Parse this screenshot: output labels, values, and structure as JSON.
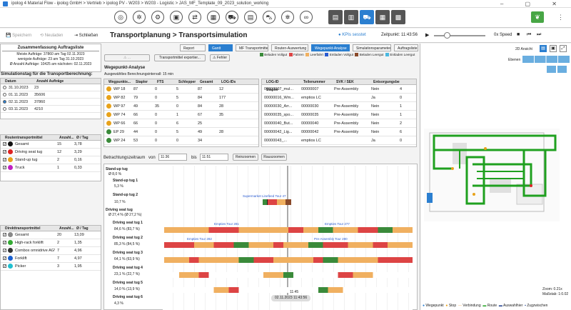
{
  "window": {
    "title": "ipolog 4 Material Flow - ipolog GmbH > Vertrieb > ipolog PV - W203 > W203 - Logistic > JAS_MF_Template_09_2023_solution_working"
  },
  "toolbar": {
    "speichern": "Speichern",
    "neuladen": "Neuladen",
    "schliessen": "Schließen",
    "title": "Transportplanung > Transportsimulation",
    "kpis": "KPIs sesstet",
    "zeitpunkt_label": "Zeitpunkt:",
    "zeitpunkt": "11:43:56",
    "speed": "0x Speed"
  },
  "summary": {
    "title": "Zusammenfassung Auftragsliste",
    "line1": "Meiste Aufträge: 37860 am Tag 02.11.2023",
    "line2": "wenigste Aufträge: 23 am Tag 31.10.2023",
    "line3": "Ø Anzahl Aufträge: 10425 am nächsten: 02.11.2023",
    "sim_label": "Simulationstag für die Transportberechnung:"
  },
  "days": {
    "col1": "Datum",
    "col2": "Anzahl Aufträge",
    "rows": [
      {
        "d": "31.10.2023",
        "n": "23",
        "sel": false
      },
      {
        "d": "01.11.2023",
        "n": "35606",
        "sel": false
      },
      {
        "d": "02.11.2023",
        "n": "37860",
        "sel": true
      },
      {
        "d": "03.11.2023",
        "n": "4210",
        "sel": false
      }
    ]
  },
  "routen": {
    "col1": "Routentransportmittel",
    "col2": "Anzahl...",
    "col3": "Ø / Tag",
    "rows": [
      {
        "name": "Gesamt",
        "n": "15",
        "t": "3,78",
        "c": "#111"
      },
      {
        "name": "Driving seat tug",
        "n": "12",
        "t": "3,29",
        "c": "#d22"
      },
      {
        "name": "Stand-up tug",
        "n": "2",
        "t": "0,16",
        "c": "#e8a21a"
      },
      {
        "name": "Truck",
        "n": "1",
        "t": "0,33",
        "c": "#c020c0"
      }
    ]
  },
  "direkt": {
    "col1": "Direkttransportmittel",
    "col2": "Anzahl...",
    "col3": "Ø / Tag",
    "rows": [
      {
        "name": "Gesamt",
        "n": "20",
        "t": "13,09",
        "c": "#888"
      },
      {
        "name": "High-rack forklift",
        "n": "2",
        "t": "1,35",
        "c": "#3a3"
      },
      {
        "name": "Combox omnidrive AGV",
        "n": "7",
        "t": "4,96",
        "c": "#333"
      },
      {
        "name": "Forklift",
        "n": "7",
        "t": "4,97",
        "c": "#1a60d0"
      },
      {
        "name": "Picker",
        "n": "3",
        "t": "1,95",
        "c": "#20c0d0"
      }
    ]
  },
  "topbar": {
    "b1": "Transportmittel exportier...",
    "b2": "Fehler"
  },
  "tabs": [
    {
      "label": "Report",
      "act": false
    },
    {
      "label": "Gantt",
      "act": true
    },
    {
      "label": "MF Transportmittel",
      "act": false
    },
    {
      "label": "Routen-Auswertung",
      "act": false
    },
    {
      "label": "Wegepunkt-Analyse",
      "act": true
    },
    {
      "label": "Simulationsparameter",
      "act": false
    },
    {
      "label": "Auftragsliste",
      "act": false
    }
  ],
  "legend": {
    "a": "Beladen Vollgut",
    "b": "Fahren",
    "c": "Leerfahrt",
    "d": "Entladen Vollgut",
    "e": "Beladen Leergut",
    "f": "Entladen Leergut"
  },
  "wp": {
    "title": "Wegepunkt-Analyse",
    "interval": "Ausgewähltes Berechnungsintervall: 15 min",
    "cols": [
      "Wegpunkte...",
      "Stapler",
      "FTS",
      "Schlepper",
      "Gesamt",
      "LOG-IDs"
    ],
    "rows": [
      [
        "WP 18",
        "87",
        "0",
        "5",
        "87",
        "12"
      ],
      [
        "WP 82",
        "79",
        "0",
        "5",
        "84",
        "177"
      ],
      [
        "WP 97",
        "49",
        "35",
        "0",
        "84",
        "28"
      ],
      [
        "WP 74",
        "66",
        "0",
        "1",
        "67",
        "35"
      ],
      [
        "WP 66",
        "66",
        "0",
        "6",
        "25",
        ""
      ],
      [
        "EP 29",
        "44",
        "0",
        "5",
        "49",
        "28"
      ],
      [
        "WP 24",
        "53",
        "0",
        "0",
        "34",
        ""
      ]
    ]
  },
  "log": {
    "cols": [
      "LOG-ID",
      "Teilenummer",
      "SVK / SEK",
      "Entsorgungsbeh.",
      "Stapler"
    ],
    "rows": [
      [
        "00000007_mul...",
        "00000007",
        "Pre-Assembly",
        "Nein",
        "4"
      ],
      [
        "00000016_Wm...",
        "emptios LC",
        "",
        "Ja",
        "0"
      ],
      [
        "00000030_Arr...",
        "00000030",
        "Pre-Assembly",
        "Nein",
        "1"
      ],
      [
        "00000035_spo...",
        "00000035",
        "Pre-Assembly",
        "Nein",
        "1"
      ],
      [
        "00000040_But...",
        "00000040",
        "Pre-Assembly",
        "Nein",
        "2"
      ],
      [
        "00000042_Lig...",
        "00000042",
        "Pre-Assembly",
        "Nein",
        "6"
      ],
      [
        "00000043_...",
        "emptios LC",
        "",
        "Ja",
        "0"
      ]
    ]
  },
  "range": {
    "label": "Betrachtungszeitraum",
    "von": "von",
    "from": "11:36",
    "bis": "bis",
    "to": "11:51",
    "zoomin": "Reinzoomen",
    "zoomout": "Rauszoomen"
  },
  "gantt": {
    "g1": "Stand-up tug",
    "g1s": "Ø 8,0 %",
    "l1": "Stand-up tug 1",
    "l1s": "5,3 %",
    "l2": "Stand-up tug 2",
    "l2s": "10,7 %",
    "g2": "Driving seat tug",
    "g2s": "Ø 27,4 % (Ø 27,2 %)",
    "d1": "Driving seat tug 1",
    "d1s": "84,6 % (83,7 %)",
    "d2": "Driving seat tug 2",
    "d2s": "85,3 % (84,5 %)",
    "d3": "Driving seat tug 3",
    "d3s": "64,1 % (63,9 %)",
    "d4": "Driving seat tug 4",
    "d4s": "23,1 % (22,7 %)",
    "d5": "Driving seat tug 5",
    "d5s": "14,0 % (13,9 %)",
    "d6": "Driving seat tug 6",
    "d6s": "4,3 %",
    "t1": "Supermarket Linefeed Tour 47",
    "t2": "Empties Tour 281",
    "t3": "Empties Tour 277",
    "t4": "Empties Tour 282",
    "t5": "Pre-Assembly Tour 280",
    "cursor_time": "11:45",
    "cursor_date": "02.11.2023 11:43:56"
  },
  "map": {
    "title": "2D Ansicht",
    "ebenen": "Ebenen",
    "zoom": "Zoom: 0.21x",
    "scale": "Maßstab: 1:0.02"
  },
  "maplegend": {
    "a": "Wegepunkt",
    "b": "Stop",
    "c": "Verbindung",
    "d": "Route",
    "e": "Auswahlhier",
    "f": "Zugzwischen"
  }
}
